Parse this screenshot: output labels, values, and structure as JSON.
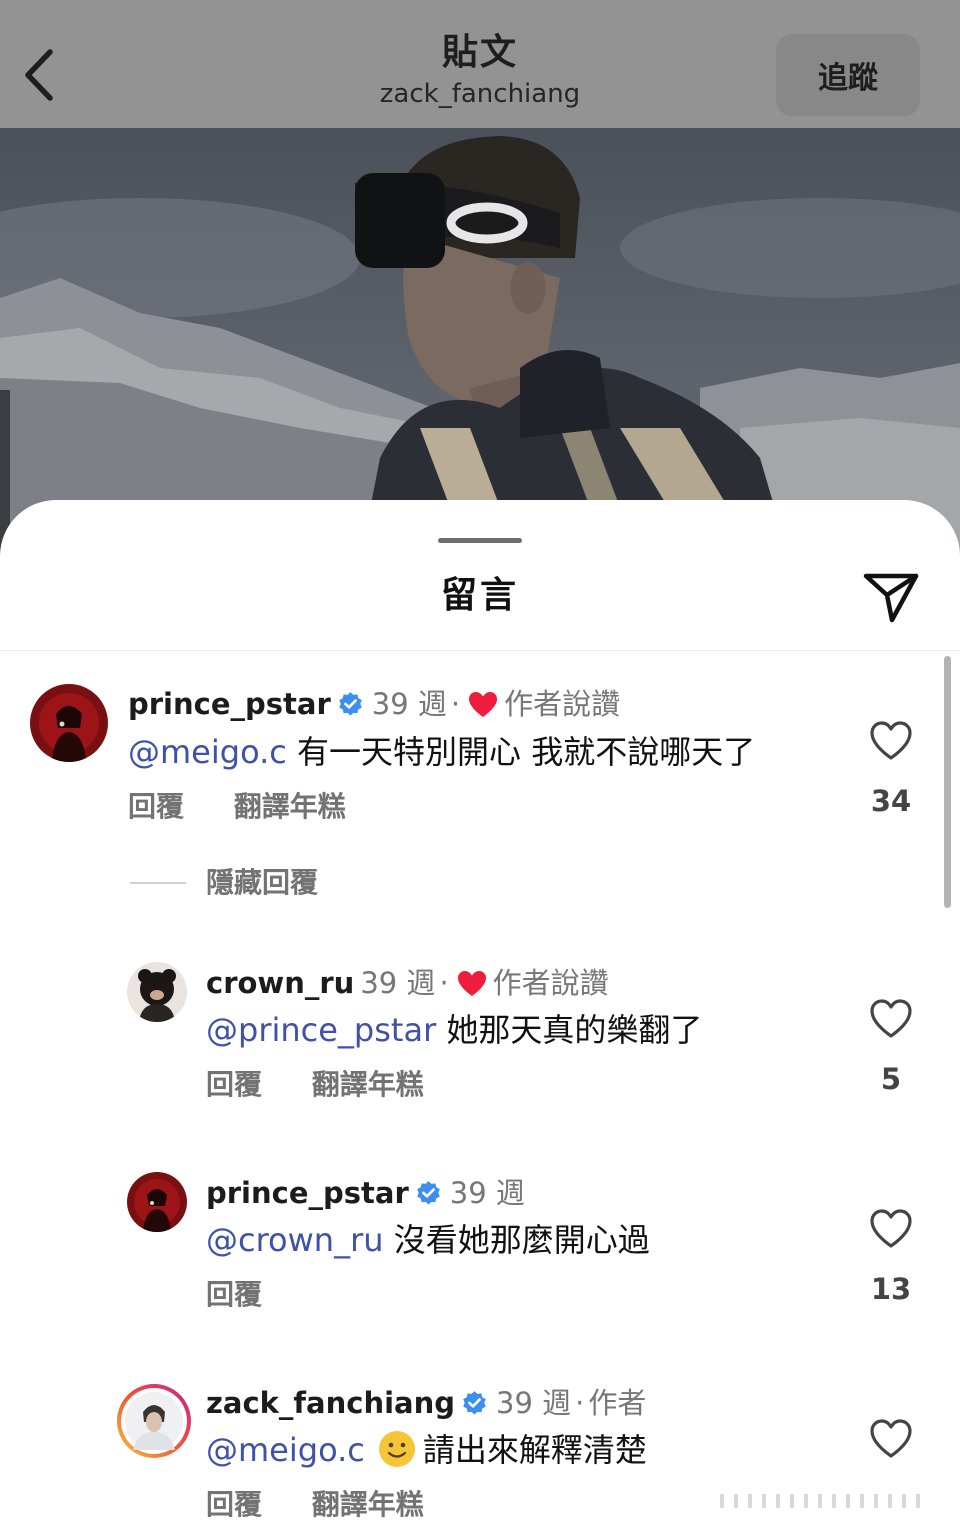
{
  "header": {
    "title": "貼文",
    "username": "zack_fanchiang",
    "follow_label": "追蹤"
  },
  "sheet": {
    "title": "留言",
    "hide_replies_label": "隱藏回覆"
  },
  "comments": [
    {
      "username": "prince_pstar",
      "verified": true,
      "time": "39 週",
      "separator": "·",
      "liked_by_author_label": "作者說讚",
      "mention": "@meigo.c",
      "text": "有一天特別開心 我就不說哪天了",
      "reply_label": "回覆",
      "translate_label": "翻譯年糕",
      "like_count": "34"
    },
    {
      "username": "crown_ru",
      "verified": false,
      "time": "39 週",
      "separator": "·",
      "liked_by_author_label": "作者說讚",
      "mention": "@prince_pstar",
      "text": "她那天真的樂翻了",
      "reply_label": "回覆",
      "translate_label": "翻譯年糕",
      "like_count": "5"
    },
    {
      "username": "prince_pstar",
      "verified": true,
      "time": "39 週",
      "mention": "@crown_ru",
      "text": "沒看她那麼開心過",
      "reply_label": "回覆",
      "like_count": "13"
    },
    {
      "username": "zack_fanchiang",
      "verified": true,
      "time": "39 週",
      "separator": "·",
      "author_label": "作者",
      "mention": "@meigo.c",
      "emoji": "slightly-smiling-face",
      "text": "請出來解釋清楚",
      "reply_label": "回覆",
      "translate_label": "翻譯年糕"
    }
  ],
  "colors": {
    "mention": "#3f51a8",
    "verified": "#3b8ff0",
    "heart": "#ee1d3c",
    "secondary_text": "#777777"
  },
  "icons": {
    "back": "chevron-left-icon",
    "share": "paper-plane-icon",
    "like": "heart-outline-icon",
    "liked_by_author": "heart-filled-icon",
    "verified": "verified-badge-icon"
  }
}
